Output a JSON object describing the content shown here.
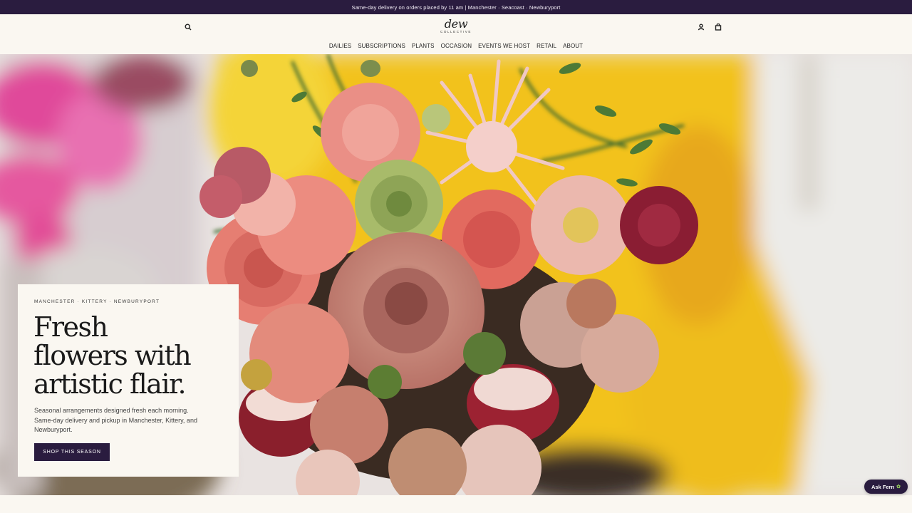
{
  "announcement": "Same-day delivery on orders placed by 11 am | Manchester · Seacoast · Newburyport",
  "logo": {
    "word": "dew",
    "sub": "COLLECTIVE"
  },
  "header_icons": [
    "search-icon",
    "account-icon",
    "cart-icon"
  ],
  "nav": [
    "DAILIES",
    "SUBSCRIPTIONS",
    "PLANTS",
    "OCCASION",
    "EVENTS WE HOST",
    "RETAIL",
    "ABOUT"
  ],
  "hero": {
    "eyebrow": "MANCHESTER · KITTERY · NEWBURYPORT",
    "headline_line1": "Fresh",
    "headline_line2": "flowers with",
    "headline_line3": "artistic flair.",
    "subtext": "Seasonal arrangements designed fresh each morning. Same-day delivery and pickup in Manchester, Kittery, and Newburyport.",
    "cta": "SHOP THIS SEASON"
  },
  "chat_button": {
    "label": "Ask Fern",
    "icon": "leaf-icon"
  },
  "colors": {
    "brand": "#2a1c3f",
    "cream": "#faf7f1",
    "yellow": "#f1c22a"
  }
}
